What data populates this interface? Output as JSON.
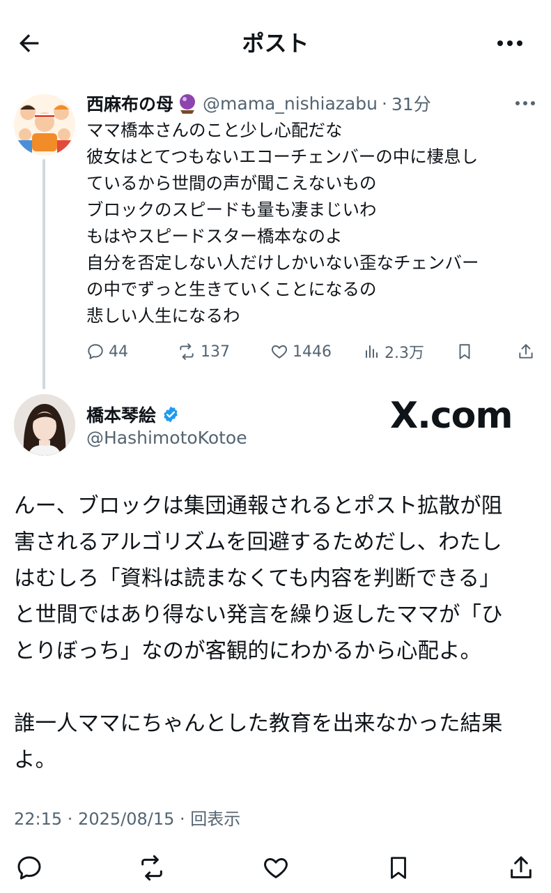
{
  "header": {
    "title": "ポスト"
  },
  "parent_post": {
    "author_name": "西麻布の母",
    "handle": "@mama_nishiazabu",
    "separator": "·",
    "time": "31分",
    "lines": [
      "ママ橋本さんのこと少し心配だな",
      "彼女はとてつもないエコーチェンバーの中に棲息し",
      "ているから世間の声が聞こえないもの",
      "ブロックのスピードも量も凄まじいわ",
      "もはやスピードスター橋本なのよ",
      "自分を否定しない人だけしかいない歪なチェンバー",
      "の中でずっと生きていくことになるの",
      "悲しい人生になるわ"
    ],
    "stats": {
      "replies": "44",
      "reposts": "137",
      "likes": "1446",
      "views": "2.3万"
    }
  },
  "main_post": {
    "author_name": "橋本琴絵",
    "handle": "@HashimotoKotoe",
    "watermark": "X.com",
    "lines": [
      "んー、ブロックは集団通報されるとポスト拡散が阻",
      "害されるアルゴリズムを回避するためだし、わたし",
      "はむしろ「資料は読まなくても内容を判断できる」",
      "と世間ではあり得ない発言を繰り返したママが「ひ",
      "とりぼっち」なのが客観的にわかるから心配よ。",
      "",
      "誰一人ママにちゃんとした教育を出来なかった結果",
      "よ。"
    ],
    "timestamp": "22:15 · 2025/08/15 · 回表示"
  },
  "colors": {
    "text": "#0f1419",
    "muted": "#536471",
    "verified": "#1d9bf0",
    "thread_line": "#cfd9de"
  },
  "icons": [
    "back-arrow-icon",
    "more-icon",
    "reply-icon",
    "repost-icon",
    "like-icon",
    "views-icon",
    "bookmark-icon",
    "share-icon",
    "verified-badge-icon",
    "crystal-ball-icon"
  ]
}
